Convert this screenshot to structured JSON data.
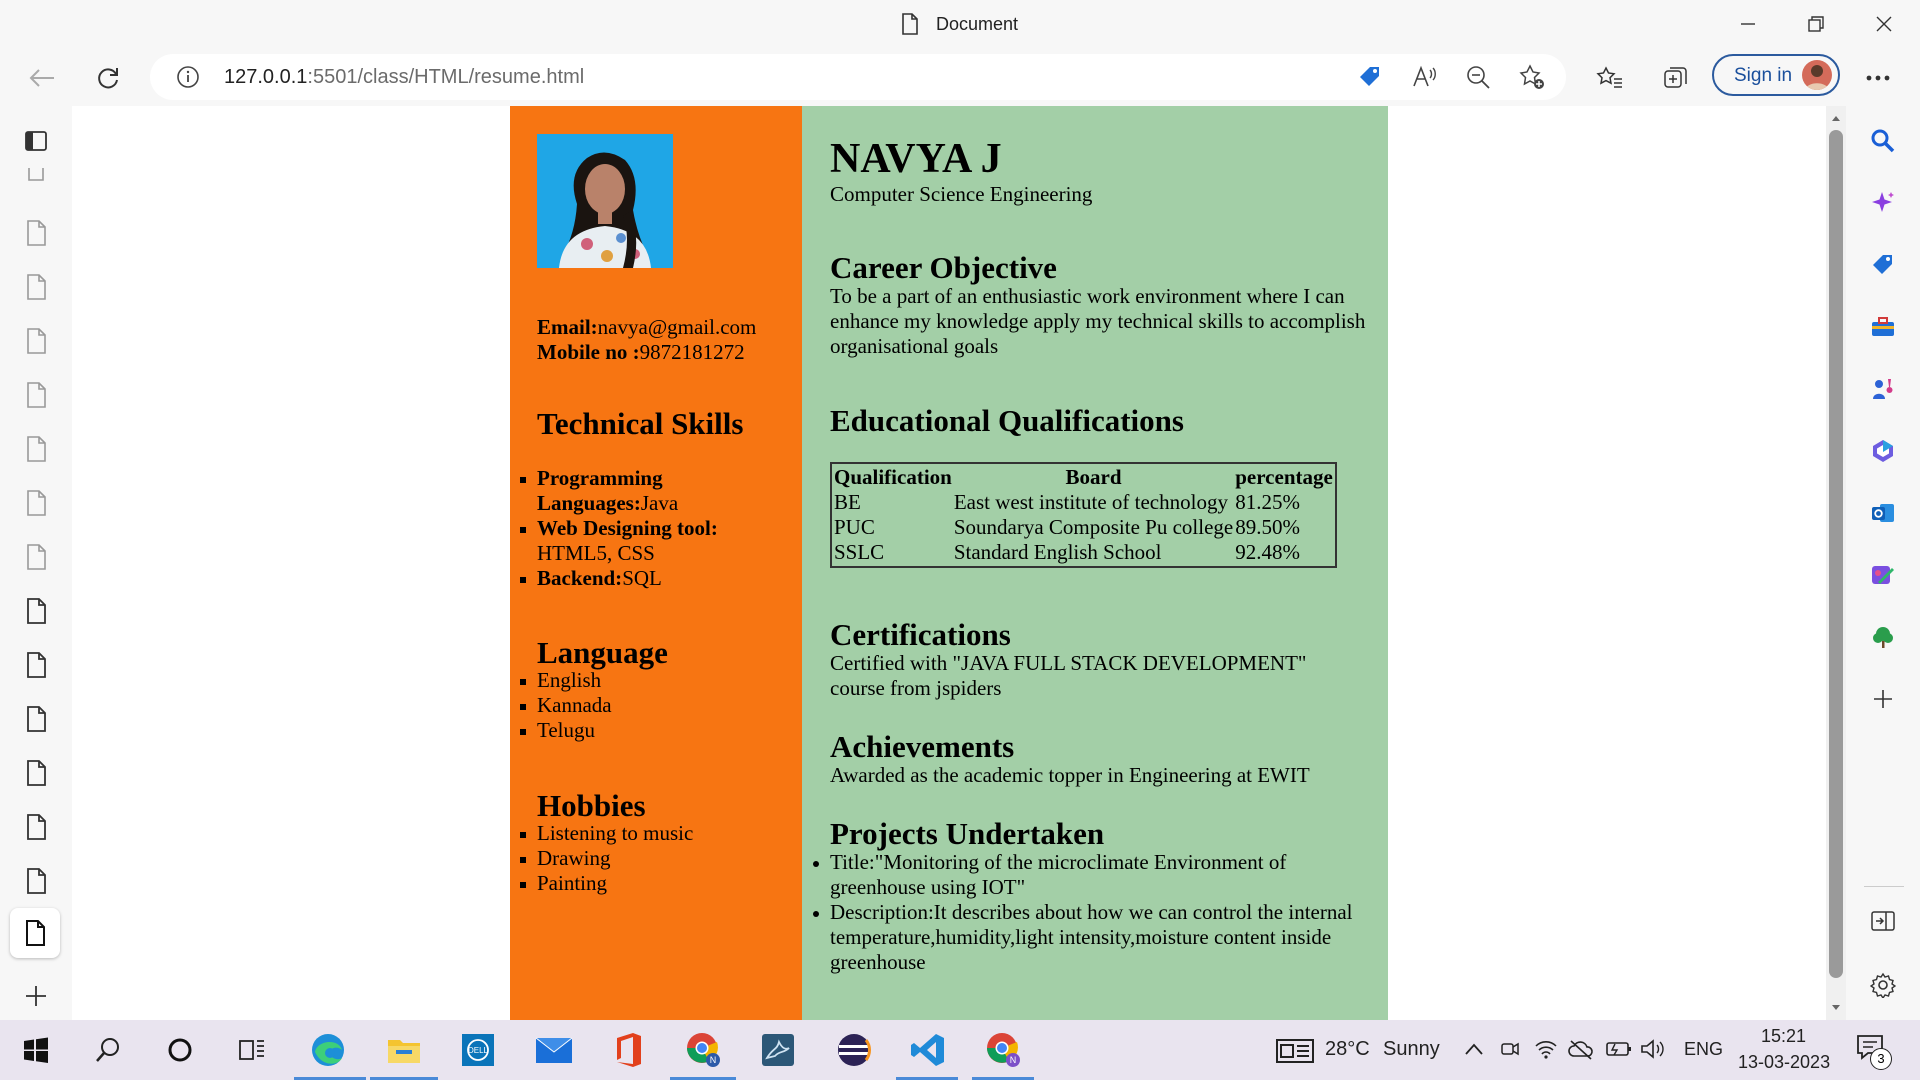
{
  "window": {
    "title": "Document"
  },
  "toolbar": {
    "url_host": "127.0.0.1",
    "url_rest": ":5501/class/HTML/resume.html",
    "signin_label": "Sign in"
  },
  "resume": {
    "name": "NAVYA J",
    "subtitle": "Computer Science Engineering",
    "contact": {
      "email_label": "Email:",
      "email": "navya@gmail.com",
      "mobile_label": "Mobile no :",
      "mobile": "9872181272"
    },
    "skills": {
      "heading": "Technical Skills",
      "items": [
        {
          "label": "Programming Languages:",
          "value": "Java"
        },
        {
          "label": "Web Designing tool:",
          "value": " HTML5, CSS"
        },
        {
          "label": "Backend:",
          "value": "SQL"
        }
      ]
    },
    "language": {
      "heading": "Language",
      "items": [
        "English",
        "Kannada",
        "Telugu"
      ]
    },
    "hobbies": {
      "heading": "Hobbies",
      "items": [
        "Listening to music",
        "Drawing",
        "Painting"
      ]
    },
    "objective": {
      "heading": "Career Objective",
      "text": "To be a part of an enthusiastic work environment where I can enhance my knowledge apply my technical skills to accomplish organisational goals"
    },
    "education": {
      "heading": "Educational Qualifications",
      "headers": [
        "Qualification",
        "Board",
        "percentage"
      ],
      "rows": [
        [
          "BE",
          "East west institute of technology",
          "81.25%"
        ],
        [
          "PUC",
          "Soundarya Composite Pu college",
          "89.50%"
        ],
        [
          "SSLC",
          "Standard English School",
          "92.48%"
        ]
      ]
    },
    "certifications": {
      "heading": "Certifications",
      "text": "Certified with \"JAVA FULL STACK DEVELOPMENT\" course from jspiders"
    },
    "achievements": {
      "heading": "Achievements",
      "text": "Awarded as the academic topper in Engineering at EWIT"
    },
    "projects": {
      "heading": "Projects Undertaken",
      "items": [
        "Title:\"Monitoring of the microclimate Environment of greenhouse using IOT\"",
        "Description:It describes about how we can control the internal temperature,humidity,light intensity,moisture content inside greenhouse"
      ]
    }
  },
  "taskbar": {
    "weather": "28°C",
    "weather_desc": "Sunny",
    "lang": "ENG",
    "time": "15:21",
    "date": "13-03-2023",
    "notif_count": "3"
  },
  "icons": {
    "titlebar": [
      "document-icon",
      "minimize-icon",
      "restore-icon",
      "close-icon"
    ],
    "toolbar": [
      "back-icon",
      "refresh-icon",
      "info-icon",
      "shopping-tag-icon",
      "read-aloud-icon",
      "zoom-out-icon",
      "add-favorite-icon",
      "favorites-icon",
      "collections-icon",
      "more-icon"
    ],
    "sidebar": [
      "search-icon",
      "copilot-icon",
      "shopping-icon",
      "tools-icon",
      "games-icon",
      "office-icon",
      "outlook-icon",
      "designer-icon",
      "tree-icon",
      "add-icon",
      "split-screen-icon",
      "settings-icon"
    ]
  }
}
